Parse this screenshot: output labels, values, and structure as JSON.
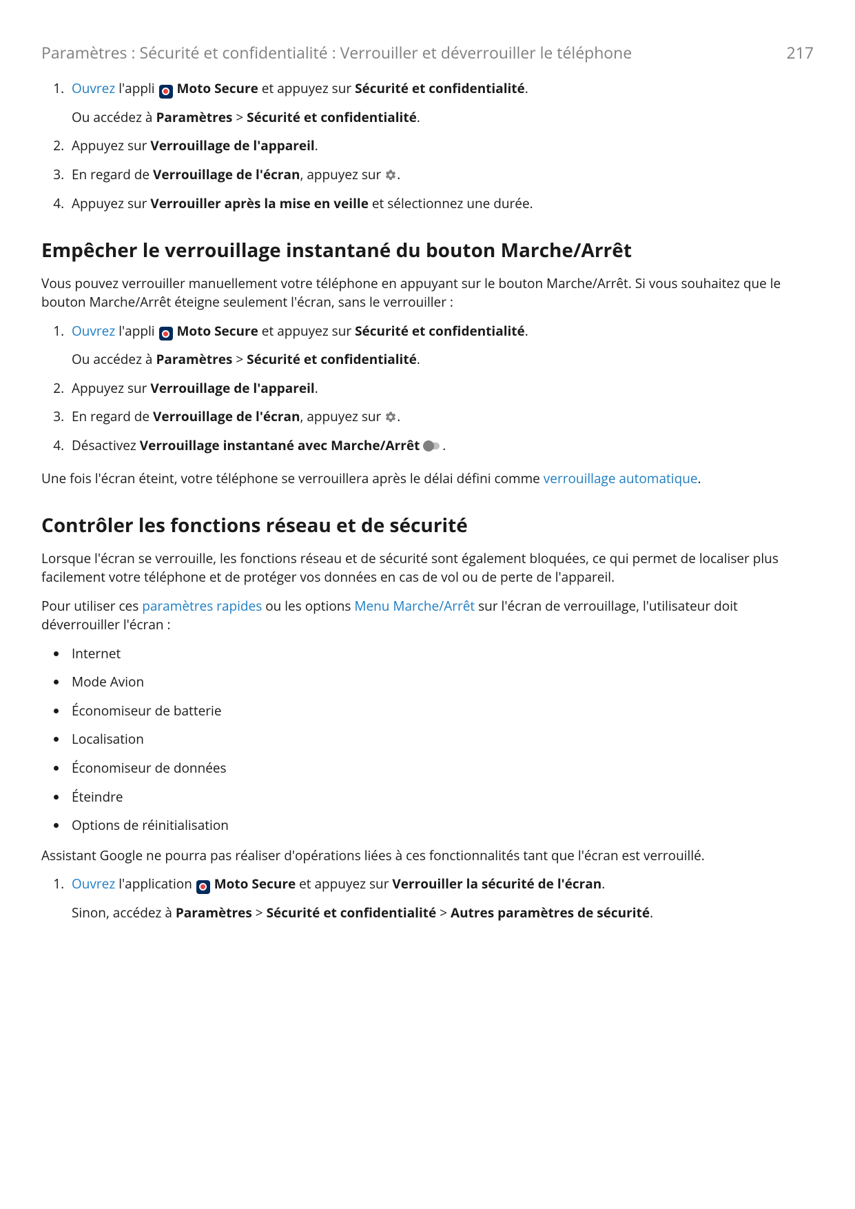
{
  "header": {
    "breadcrumb": "Paramètres : Sécurité et confidentialité : Verrouiller et déverrouiller le téléphone",
    "page_number": "217"
  },
  "common": {
    "open_link": "Ouvrez",
    "app_name": "Moto Secure",
    "the_app_text": " l'appli ",
    "the_application_text": " l'application ",
    "and_tap": " et appuyez sur ",
    "security_priv": "Sécurité et confidentialité",
    "or_go_to": "Ou accédez à ",
    "settings": "Paramètres",
    "chevron": ">",
    "other_security": "Autres paramètres de sécurité",
    "period": "."
  },
  "section_a": {
    "steps": {
      "s2": {
        "prefix": "Appuyez sur ",
        "bold": "Verrouillage de l'appareil",
        "suffix": "."
      },
      "s3": {
        "prefix": "En regard de ",
        "bold": "Verrouillage de l'écran",
        "middle": ", appuyez sur ",
        "suffix": "."
      },
      "s4": {
        "prefix": "Appuyez sur ",
        "bold": "Verrouiller après la mise en veille",
        "suffix": " et sélectionnez une durée."
      }
    }
  },
  "section_b": {
    "heading": "Empêcher le verrouillage instantané du bouton Marche/Arrêt",
    "intro": "Vous pouvez verrouiller manuellement votre téléphone en appuyant sur le bouton Marche/Arrêt. Si vous souhaitez que le bouton Marche/Arrêt éteigne seulement l'écran, sans le verrouiller :",
    "steps": {
      "s2": {
        "prefix": "Appuyez sur ",
        "bold": "Verrouillage de l'appareil",
        "suffix": "."
      },
      "s3": {
        "prefix": "En regard de ",
        "bold": "Verrouillage de l'écran",
        "middle": ", appuyez sur ",
        "suffix": "."
      },
      "s4": {
        "prefix": "Désactivez ",
        "bold": "Verrouillage instantané avec Marche/Arrêt",
        "suffix": "."
      }
    },
    "outro_prefix": "Une fois l'écran éteint, votre téléphone se verrouillera après le délai défini comme ",
    "outro_link": "verrouillage automatique",
    "outro_suffix": "."
  },
  "section_c": {
    "heading": "Contrôler les fonctions réseau et de sécurité",
    "intro": "Lorsque l'écran se verrouille, les fonctions réseau et de sécurité sont également bloquées, ce qui permet de localiser plus facilement votre téléphone et de protéger vos données en cas de vol ou de perte de l'appareil.",
    "para2_prefix": "Pour utiliser ces ",
    "para2_link1": "paramètres rapides",
    "para2_mid": " ou les options ",
    "para2_link2": "Menu Marche/Arrêt",
    "para2_suffix": " sur l'écran de verrouillage, l'utilisateur doit déverrouiller l'écran :",
    "bullets": [
      "Internet",
      "Mode Avion",
      "Économiseur de batterie",
      "Localisation",
      "Économiseur de données",
      "Éteindre",
      "Options de réinitialisation"
    ],
    "para3": "Assistant Google ne pourra pas réaliser d'opérations liées à ces fonctionnalités tant que l'écran est verrouillé.",
    "step1_tap_on": "Verrouiller la sécurité de l'écran",
    "step1_alt_prefix": "Sinon, accédez à "
  }
}
